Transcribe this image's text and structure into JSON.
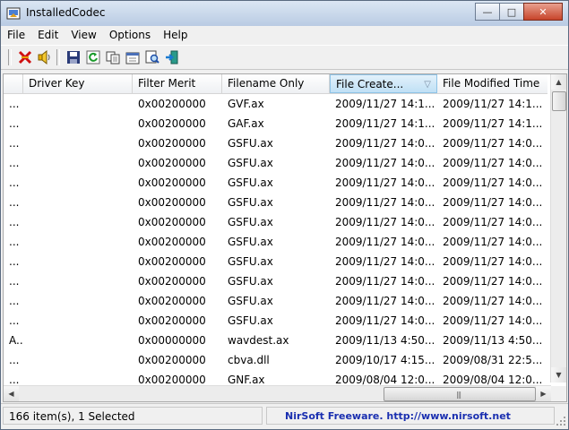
{
  "window": {
    "title": "InstalledCodec",
    "accent": "#c7442a"
  },
  "menu": [
    "File",
    "Edit",
    "View",
    "Options",
    "Help"
  ],
  "toolbar": {
    "icons": [
      "disable-icon",
      "enable-icon",
      "save-icon",
      "refresh-icon",
      "copy-icon",
      "properties-icon",
      "find-icon",
      "exit-icon"
    ]
  },
  "table": {
    "columns": [
      {
        "label": ""
      },
      {
        "label": "Driver Key"
      },
      {
        "label": "Filter Merit"
      },
      {
        "label": "Filename Only"
      },
      {
        "label": "File Create...",
        "sorted": true
      },
      {
        "label": "File Modified Time"
      }
    ],
    "rows": [
      {
        "c0": "...",
        "driver": "",
        "merit": "0x00200000",
        "file": "GVF.ax",
        "created": "2009/11/27 14:1...",
        "modified": "2009/11/27 14:1..."
      },
      {
        "c0": "...",
        "driver": "",
        "merit": "0x00200000",
        "file": "GAF.ax",
        "created": "2009/11/27 14:1...",
        "modified": "2009/11/27 14:1..."
      },
      {
        "c0": "...",
        "driver": "",
        "merit": "0x00200000",
        "file": "GSFU.ax",
        "created": "2009/11/27 14:0...",
        "modified": "2009/11/27 14:0..."
      },
      {
        "c0": "...",
        "driver": "",
        "merit": "0x00200000",
        "file": "GSFU.ax",
        "created": "2009/11/27 14:0...",
        "modified": "2009/11/27 14:0..."
      },
      {
        "c0": "...",
        "driver": "",
        "merit": "0x00200000",
        "file": "GSFU.ax",
        "created": "2009/11/27 14:0...",
        "modified": "2009/11/27 14:0..."
      },
      {
        "c0": "...",
        "driver": "",
        "merit": "0x00200000",
        "file": "GSFU.ax",
        "created": "2009/11/27 14:0...",
        "modified": "2009/11/27 14:0..."
      },
      {
        "c0": "...",
        "driver": "",
        "merit": "0x00200000",
        "file": "GSFU.ax",
        "created": "2009/11/27 14:0...",
        "modified": "2009/11/27 14:0..."
      },
      {
        "c0": "...",
        "driver": "",
        "merit": "0x00200000",
        "file": "GSFU.ax",
        "created": "2009/11/27 14:0...",
        "modified": "2009/11/27 14:0..."
      },
      {
        "c0": "...",
        "driver": "",
        "merit": "0x00200000",
        "file": "GSFU.ax",
        "created": "2009/11/27 14:0...",
        "modified": "2009/11/27 14:0..."
      },
      {
        "c0": "...",
        "driver": "",
        "merit": "0x00200000",
        "file": "GSFU.ax",
        "created": "2009/11/27 14:0...",
        "modified": "2009/11/27 14:0..."
      },
      {
        "c0": "...",
        "driver": "",
        "merit": "0x00200000",
        "file": "GSFU.ax",
        "created": "2009/11/27 14:0...",
        "modified": "2009/11/27 14:0..."
      },
      {
        "c0": "...",
        "driver": "",
        "merit": "0x00200000",
        "file": "GSFU.ax",
        "created": "2009/11/27 14:0...",
        "modified": "2009/11/27 14:0..."
      },
      {
        "c0": "A...",
        "driver": "",
        "merit": "0x00000000",
        "file": "wavdest.ax",
        "created": "2009/11/13 4:50...",
        "modified": "2009/11/13 4:50..."
      },
      {
        "c0": "...",
        "driver": "",
        "merit": "0x00200000",
        "file": "cbva.dll",
        "created": "2009/10/17 4:15...",
        "modified": "2009/08/31 22:5..."
      },
      {
        "c0": "...",
        "driver": "",
        "merit": "0x00200000",
        "file": "GNF.ax",
        "created": "2009/08/04 12:0...",
        "modified": "2009/08/04 12:0..."
      }
    ]
  },
  "status": {
    "items": "166 item(s), 1 Selected",
    "credit": "NirSoft Freeware.  http://www.nirsoft.net"
  }
}
